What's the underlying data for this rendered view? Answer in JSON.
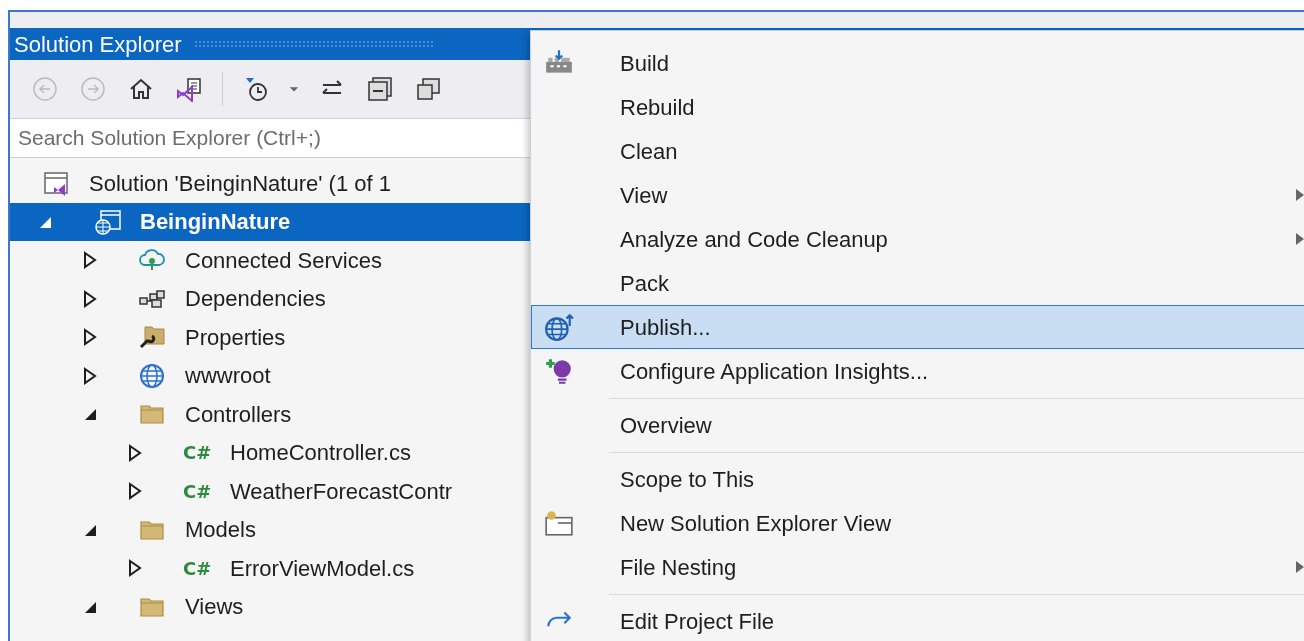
{
  "panel": {
    "title": "Solution Explorer"
  },
  "toolbar": [
    {
      "kind": "back",
      "disabled": true
    },
    {
      "kind": "forward",
      "disabled": true
    },
    {
      "kind": "home",
      "disabled": false
    },
    {
      "kind": "switch-views",
      "disabled": false
    },
    {
      "kind": "separator"
    },
    {
      "kind": "pending-changes",
      "disabled": false
    },
    {
      "kind": "dropdown",
      "disabled": false
    },
    {
      "kind": "sync",
      "disabled": false
    },
    {
      "kind": "collapse-all",
      "disabled": false
    },
    {
      "kind": "show-all",
      "disabled": false
    }
  ],
  "search": {
    "placeholder": "Search Solution Explorer (Ctrl+;)"
  },
  "tree": [
    {
      "label": "Solution 'BeinginNature' (1 of 1",
      "kind": "solution",
      "selected": false,
      "children": [
        {
          "label": "BeinginNature",
          "kind": "web-project",
          "selected": true,
          "expanded": true,
          "children": [
            {
              "label": "Connected Services",
              "kind": "connected",
              "selected": false,
              "expanded": false
            },
            {
              "label": "Dependencies",
              "kind": "dependencies",
              "selected": false,
              "expanded": false
            },
            {
              "label": "Properties",
              "kind": "properties",
              "selected": false,
              "expanded": false
            },
            {
              "label": "wwwroot",
              "kind": "globe",
              "selected": false,
              "expanded": false
            },
            {
              "label": "Controllers",
              "kind": "folder",
              "selected": false,
              "expanded": true,
              "children": [
                {
                  "label": "HomeController.cs",
                  "kind": "csharp",
                  "badge": "C#",
                  "selected": false,
                  "expanded": false
                },
                {
                  "label": "WeatherForecastContr",
                  "kind": "csharp",
                  "badge": "C#",
                  "selected": false,
                  "expanded": false
                }
              ]
            },
            {
              "label": "Models",
              "kind": "folder",
              "selected": false,
              "expanded": true,
              "children": [
                {
                  "label": "ErrorViewModel.cs",
                  "kind": "csharp",
                  "badge": "C#",
                  "selected": false,
                  "expanded": false
                }
              ]
            },
            {
              "label": "Views",
              "kind": "folder",
              "selected": false,
              "expanded": true
            }
          ]
        }
      ]
    }
  ],
  "context_menu": [
    {
      "kind": "build",
      "label": "Build",
      "selected": false,
      "submenu": false
    },
    {
      "kind": "none",
      "label": "Rebuild",
      "selected": false,
      "submenu": false
    },
    {
      "kind": "none",
      "label": "Clean",
      "selected": false,
      "submenu": false
    },
    {
      "kind": "none",
      "label": "View",
      "selected": false,
      "submenu": true
    },
    {
      "kind": "none",
      "label": "Analyze and Code Cleanup",
      "selected": false,
      "submenu": true
    },
    {
      "kind": "none",
      "label": "Pack",
      "selected": false,
      "submenu": false
    },
    {
      "kind": "publish",
      "label": "Publish...",
      "selected": true,
      "submenu": false
    },
    {
      "kind": "insights",
      "label": "Configure Application Insights...",
      "selected": false,
      "submenu": false
    },
    {
      "kind": "separator"
    },
    {
      "kind": "none",
      "label": "Overview",
      "selected": false,
      "submenu": false
    },
    {
      "kind": "separator"
    },
    {
      "kind": "none",
      "label": "Scope to This",
      "selected": false,
      "submenu": false
    },
    {
      "kind": "new-view",
      "label": "New Solution Explorer View",
      "selected": false,
      "submenu": false
    },
    {
      "kind": "none",
      "label": "File Nesting",
      "selected": false,
      "submenu": true
    },
    {
      "kind": "separator"
    },
    {
      "kind": "edit",
      "label": "Edit Project File",
      "selected": false,
      "submenu": false
    }
  ]
}
